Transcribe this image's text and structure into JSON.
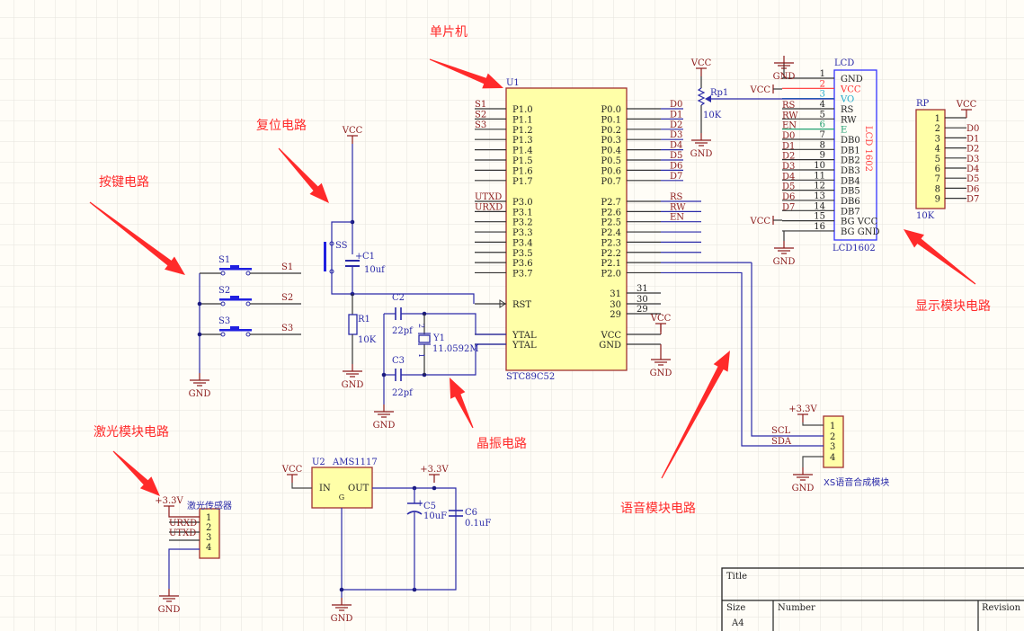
{
  "colors": {
    "annotation": "#ff2a2a",
    "net_label": "#8b1a1a",
    "wire": "#2a2aa8",
    "pin": "#333333",
    "part_fill": "#ffffa8",
    "part_stroke": "#a03030",
    "lcd_stroke": "#3333ff"
  },
  "annotations": {
    "mcu": "单片机",
    "reset": "复位电路",
    "keys": "按键电路",
    "display": "显示模块电路",
    "crystal": "晶振电路",
    "voice": "语音模块电路",
    "laser": "激光模块电路"
  },
  "power": {
    "vcc": "VCC",
    "gnd": "GND",
    "v33": "+3.3V"
  },
  "mcu": {
    "designator": "U1",
    "part": "STC89C52",
    "left_pins": [
      {
        "pin": "P1.0",
        "net": "S1"
      },
      {
        "pin": "P1.1",
        "net": "S2"
      },
      {
        "pin": "P1.2",
        "net": "S3"
      },
      {
        "pin": "P1.3",
        "net": ""
      },
      {
        "pin": "P1.4",
        "net": ""
      },
      {
        "pin": "P1.5",
        "net": ""
      },
      {
        "pin": "P1.6",
        "net": ""
      },
      {
        "pin": "P1.7",
        "net": ""
      },
      {
        "pin": "P3.0",
        "net": "UTXD"
      },
      {
        "pin": "P3.1",
        "net": "URXD"
      },
      {
        "pin": "P3.2",
        "net": ""
      },
      {
        "pin": "P3.3",
        "net": ""
      },
      {
        "pin": "P3.4",
        "net": ""
      },
      {
        "pin": "P3.5",
        "net": ""
      },
      {
        "pin": "P3.6",
        "net": ""
      },
      {
        "pin": "P3.7",
        "net": ""
      }
    ],
    "left_special": [
      "RST",
      "YTAL",
      "YTAL"
    ],
    "right_pins": [
      {
        "pin": "P0.0",
        "net": "D0"
      },
      {
        "pin": "P0.1",
        "net": "D1"
      },
      {
        "pin": "P0.2",
        "net": "D2"
      },
      {
        "pin": "P0.3",
        "net": "D3"
      },
      {
        "pin": "P0.4",
        "net": "D4"
      },
      {
        "pin": "P0.5",
        "net": "D5"
      },
      {
        "pin": "P0.6",
        "net": "D6"
      },
      {
        "pin": "P0.7",
        "net": "D7"
      },
      {
        "pin": "P2.7",
        "net": "RS"
      },
      {
        "pin": "P2.6",
        "net": "RW"
      },
      {
        "pin": "P2.5",
        "net": "EN"
      },
      {
        "pin": "P2.4",
        "net": ""
      },
      {
        "pin": "P2.3",
        "net": ""
      },
      {
        "pin": "P2.2",
        "net": ""
      },
      {
        "pin": "P2.1",
        "net": ""
      },
      {
        "pin": "P2.0",
        "net": ""
      }
    ],
    "right_special": [
      {
        "pin": "31",
        "net": "31"
      },
      {
        "pin": "30",
        "net": "30"
      },
      {
        "pin": "29",
        "net": "29"
      },
      {
        "pin": "VCC",
        "net": ""
      },
      {
        "pin": "GND",
        "net": ""
      }
    ]
  },
  "lcd": {
    "designator": "LCD",
    "part": "LCD1602",
    "body_label": "LCD 1602",
    "pins": [
      {
        "num": "1",
        "name": "GND",
        "net": ""
      },
      {
        "num": "2",
        "name": "VCC",
        "net": ""
      },
      {
        "num": "3",
        "name": "VO",
        "net": ""
      },
      {
        "num": "4",
        "name": "RS",
        "net": "RS"
      },
      {
        "num": "5",
        "name": "RW",
        "net": "RW"
      },
      {
        "num": "6",
        "name": "E",
        "net": "EN"
      },
      {
        "num": "7",
        "name": "DB0",
        "net": "D0"
      },
      {
        "num": "8",
        "name": "DB1",
        "net": "D1"
      },
      {
        "num": "9",
        "name": "DB2",
        "net": "D2"
      },
      {
        "num": "10",
        "name": "DB3",
        "net": "D3"
      },
      {
        "num": "11",
        "name": "DB4",
        "net": "D4"
      },
      {
        "num": "12",
        "name": "DB5",
        "net": "D5"
      },
      {
        "num": "13",
        "name": "DB6",
        "net": "D6"
      },
      {
        "num": "14",
        "name": "DB7",
        "net": "D7"
      },
      {
        "num": "15",
        "name": "BG VCC",
        "net": ""
      },
      {
        "num": "16",
        "name": "BG GND",
        "net": ""
      }
    ]
  },
  "rp": {
    "designator": "RP",
    "value": "10K",
    "pins": [
      "1",
      "2",
      "3",
      "4",
      "5",
      "6",
      "7",
      "8",
      "9"
    ],
    "nets": [
      "",
      "D0",
      "D1",
      "D2",
      "D3",
      "D4",
      "D5",
      "D6",
      "D7"
    ]
  },
  "rp1": {
    "designator": "Rp1",
    "value": "10K"
  },
  "reset": {
    "switch": "SS",
    "cap": "C1",
    "cap_value": "10uf",
    "res": "R1",
    "res_value": "10K"
  },
  "keys": [
    {
      "designator": "S1",
      "net": "S1"
    },
    {
      "designator": "S2",
      "net": "S2"
    },
    {
      "designator": "S3",
      "net": "S3"
    }
  ],
  "crystal": {
    "c2": "C2",
    "c2_value": "22pf",
    "c3": "C3",
    "c3_value": "22pf",
    "designator": "Y1",
    "value": "11.0592M",
    "pin1": "1",
    "pin2": "2"
  },
  "laser": {
    "label": "激光传感器",
    "pins": [
      "1",
      "2",
      "3",
      "4"
    ],
    "nets": [
      "URXD",
      "UTXD"
    ]
  },
  "regulator": {
    "designator": "U2",
    "part": "AMS1117",
    "in": "IN",
    "out": "OUT",
    "gnd_pin": "G",
    "c5": "C5",
    "c5_value": "10uF",
    "c6": "C6",
    "c6_value": "0.1uF"
  },
  "voice": {
    "label": "XS语音合成模块",
    "pins": [
      "1",
      "2",
      "3",
      "4"
    ],
    "nets": [
      "SCL",
      "SDA"
    ]
  },
  "title_block": {
    "title": "Title",
    "size": "Size",
    "size_value": "A4",
    "number": "Number",
    "revision": "Revision"
  }
}
